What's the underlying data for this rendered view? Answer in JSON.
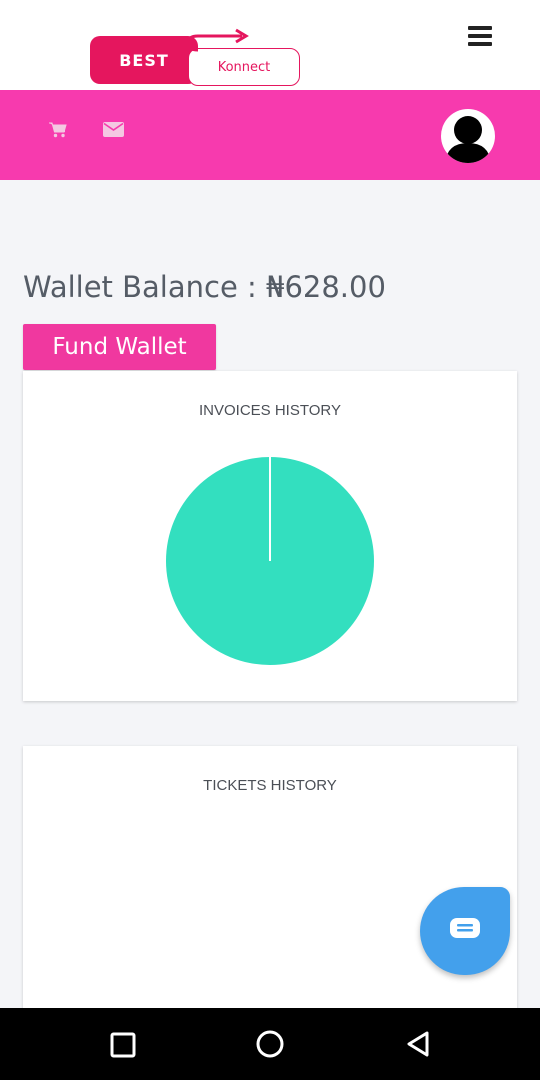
{
  "header": {
    "logo": {
      "part1": "BEST",
      "part2": "Konnect"
    },
    "menu_icon": "hamburger-menu-icon"
  },
  "toolbar": {
    "icons": [
      "cart-icon",
      "mail-icon",
      "user-avatar-icon"
    ],
    "color": "#f73aae"
  },
  "wallet": {
    "balance_text": "Wallet Balance : ₦628.00",
    "fund_button": "Fund Wallet"
  },
  "invoices_card": {
    "title": "INVOICES HISTORY"
  },
  "tickets_card": {
    "title": "TICKETS HISTORY"
  },
  "chart_data": {
    "type": "pie",
    "title": "INVOICES HISTORY",
    "slices": [
      {
        "value": 1,
        "color": "#33dfbf"
      }
    ]
  },
  "chat": {
    "icon": "chat-bubble-icon",
    "color": "#43a0ec"
  },
  "system_nav": {
    "icons": [
      "recents-square-icon",
      "home-circle-icon",
      "back-triangle-icon"
    ]
  }
}
